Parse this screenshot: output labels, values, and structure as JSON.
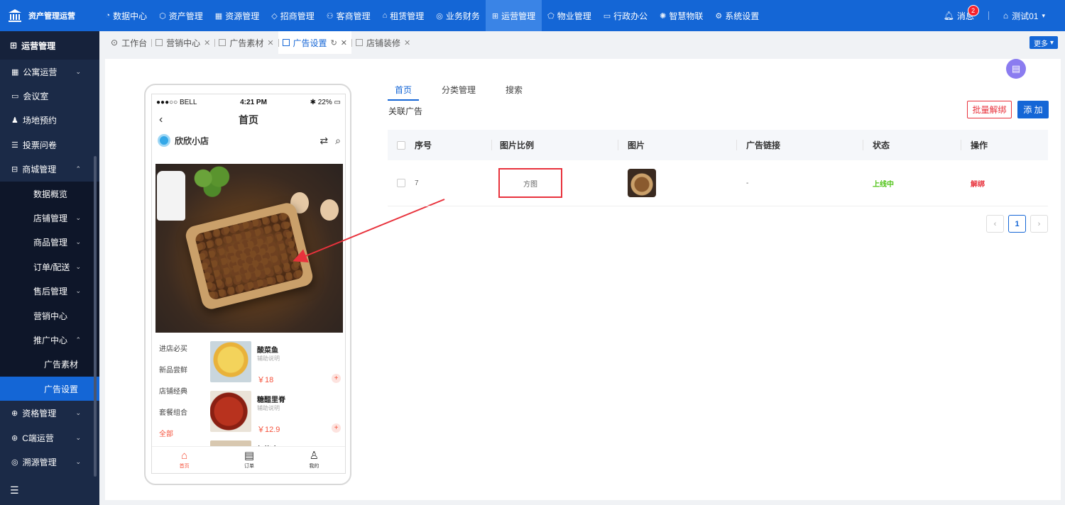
{
  "app": {
    "title": "资产管理运营"
  },
  "topnav": [
    {
      "label": "数据中心",
      "icon": "dashboard-icon"
    },
    {
      "label": "资产管理",
      "icon": "cube-icon"
    },
    {
      "label": "资源管理",
      "icon": "building-icon"
    },
    {
      "label": "招商管理",
      "icon": "tag-icon"
    },
    {
      "label": "客商管理",
      "icon": "users-icon"
    },
    {
      "label": "租赁管理",
      "icon": "home-icon"
    },
    {
      "label": "业务财务",
      "icon": "money-icon"
    },
    {
      "label": "运营管理",
      "icon": "ops-icon",
      "active": true
    },
    {
      "label": "物业管理",
      "icon": "shield-icon"
    },
    {
      "label": "行政办公",
      "icon": "monitor-icon"
    },
    {
      "label": "智慧物联",
      "icon": "iot-icon"
    },
    {
      "label": "系统设置",
      "icon": "gear-icon"
    }
  ],
  "header_right": {
    "messages_label": "消息",
    "messages_count": "2",
    "user_name": "测试01"
  },
  "sidebar": {
    "title": "运营管理",
    "items": [
      {
        "label": "公寓运营",
        "level": 0,
        "chevron": "down"
      },
      {
        "label": "会议室",
        "level": 0
      },
      {
        "label": "场地预约",
        "level": 0
      },
      {
        "label": "投票问卷",
        "level": 0
      },
      {
        "label": "商城管理",
        "level": 0,
        "chevron": "up"
      },
      {
        "label": "数据概览",
        "level": 1
      },
      {
        "label": "店铺管理",
        "level": 1,
        "chevron": "down"
      },
      {
        "label": "商品管理",
        "level": 1,
        "chevron": "down"
      },
      {
        "label": "订单/配送",
        "level": 1,
        "chevron": "down"
      },
      {
        "label": "售后管理",
        "level": 1,
        "chevron": "down"
      },
      {
        "label": "营销中心",
        "level": 1
      },
      {
        "label": "推广中心",
        "level": 1,
        "chevron": "up"
      },
      {
        "label": "广告素材",
        "level": 2
      },
      {
        "label": "广告设置",
        "level": 2,
        "active": true
      },
      {
        "label": "资格管理",
        "level": 0,
        "chevron": "down"
      },
      {
        "label": "C端运营",
        "level": 0,
        "chevron": "down"
      },
      {
        "label": "溯源管理",
        "level": 0,
        "chevron": "down"
      }
    ]
  },
  "tabs": [
    {
      "label": "工作台",
      "closable": false
    },
    {
      "label": "营销中心",
      "closable": true
    },
    {
      "label": "广告素材",
      "closable": true
    },
    {
      "label": "广告设置",
      "closable": true,
      "active": true
    },
    {
      "label": "店铺装修",
      "closable": true
    }
  ],
  "more_label": "更多",
  "phone": {
    "carrier": "●●●○○ BELL",
    "time": "4:21 PM",
    "battery": "22%",
    "page_title": "首页",
    "shop_name": "欣欣小店",
    "categories": [
      "进店必买",
      "新品尝鲜",
      "店铺经典",
      "套餐组合",
      "全部"
    ],
    "active_category": "全部",
    "goods": [
      {
        "name": "酸菜鱼",
        "desc": "辅助说明",
        "price": "￥18"
      },
      {
        "name": "糖醋里脊",
        "desc": "辅助说明",
        "price": "￥12.9"
      },
      {
        "name": "红烧肉",
        "desc": "",
        "price": ""
      }
    ],
    "tabbar": [
      {
        "label": "首页",
        "icon": "home-icon"
      },
      {
        "label": "订单",
        "icon": "order-icon"
      },
      {
        "label": "我的",
        "icon": "user-icon"
      }
    ]
  },
  "panel": {
    "tabs": [
      "首页",
      "分类管理",
      "搜索"
    ],
    "active_tab": "首页",
    "section_title": "关联广告",
    "batch_unbind_label": "批量解绑",
    "add_label": "添 加",
    "columns": [
      "序号",
      "图片比例",
      "图片",
      "广告链接",
      "状态",
      "操作"
    ],
    "rows": [
      {
        "no": "7",
        "ratio": "方图",
        "link": "-",
        "status": "上线中",
        "action": "解绑"
      }
    ],
    "pagination": {
      "current": "1"
    }
  }
}
